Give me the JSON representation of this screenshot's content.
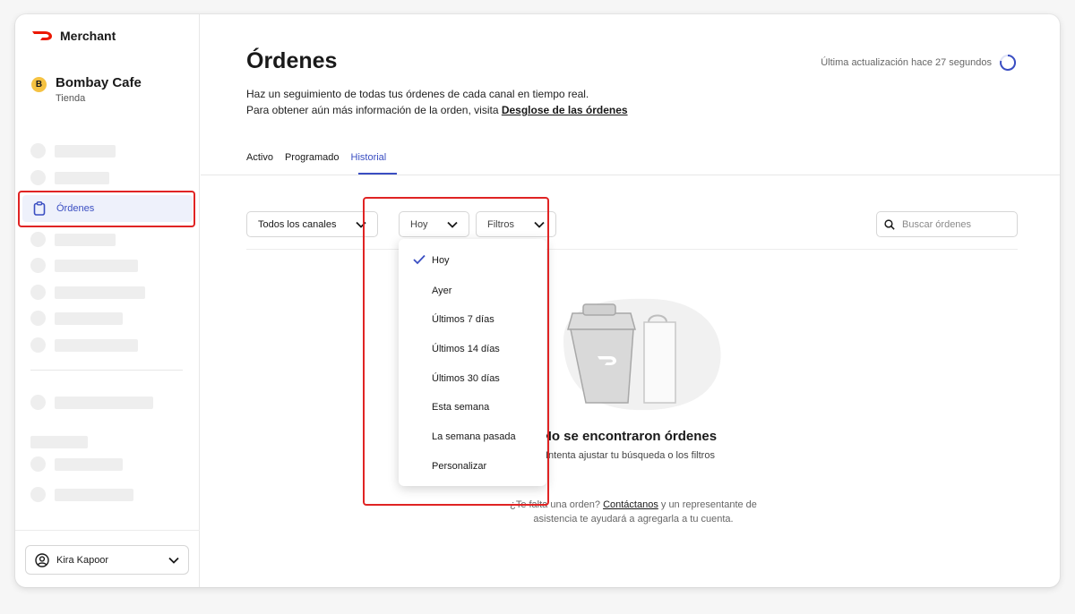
{
  "brand": {
    "name": "Merchant",
    "accent": "#eb1700"
  },
  "store": {
    "initial": "B",
    "name": "Bombay Cafe",
    "type": "Tienda"
  },
  "sidebar": {
    "active_item": {
      "label": "Órdenes",
      "icon": "clipboard-icon"
    }
  },
  "user": {
    "name": "Kira Kapoor",
    "icon": "user-circle-icon"
  },
  "page": {
    "title": "Órdenes",
    "desc_line1": "Haz un seguimiento de todas tus órdenes de cada canal en tiempo real.",
    "desc_line2": "Para obtener aún más información de la orden, visita ",
    "desc_link": "Desglose de las órdenes",
    "updated": "Última actualización hace 27 segundos"
  },
  "tabs": [
    {
      "label": "Activo"
    },
    {
      "label": "Programado"
    },
    {
      "label": "Historial"
    }
  ],
  "filters": {
    "channels": "Todos los canales",
    "date": "Hoy",
    "filters": "Filtros",
    "search_placeholder": "Buscar órdenes"
  },
  "date_options": [
    {
      "label": "Hoy",
      "selected": true
    },
    {
      "label": "Ayer",
      "selected": false
    },
    {
      "label": "Últimos 7 días",
      "selected": false
    },
    {
      "label": "Últimos 14 días",
      "selected": false
    },
    {
      "label": "Últimos 30 días",
      "selected": false
    },
    {
      "label": "Esta semana",
      "selected": false
    },
    {
      "label": "La semana pasada",
      "selected": false
    },
    {
      "label": "Personalizar",
      "selected": false
    }
  ],
  "empty": {
    "title": "No se encontraron órdenes",
    "subtitle": "Intenta ajustar tu búsqueda o los filtros"
  },
  "help": {
    "prefix": "¿Te falta una orden? ",
    "link": "Contáctanos",
    "suffix": " y un representante de asistencia te ayudará a agregarla a tu cuenta."
  },
  "colors": {
    "accent_blue": "#3a4ec2",
    "highlight_red": "#e02424",
    "badge_yellow": "#f5c242"
  }
}
